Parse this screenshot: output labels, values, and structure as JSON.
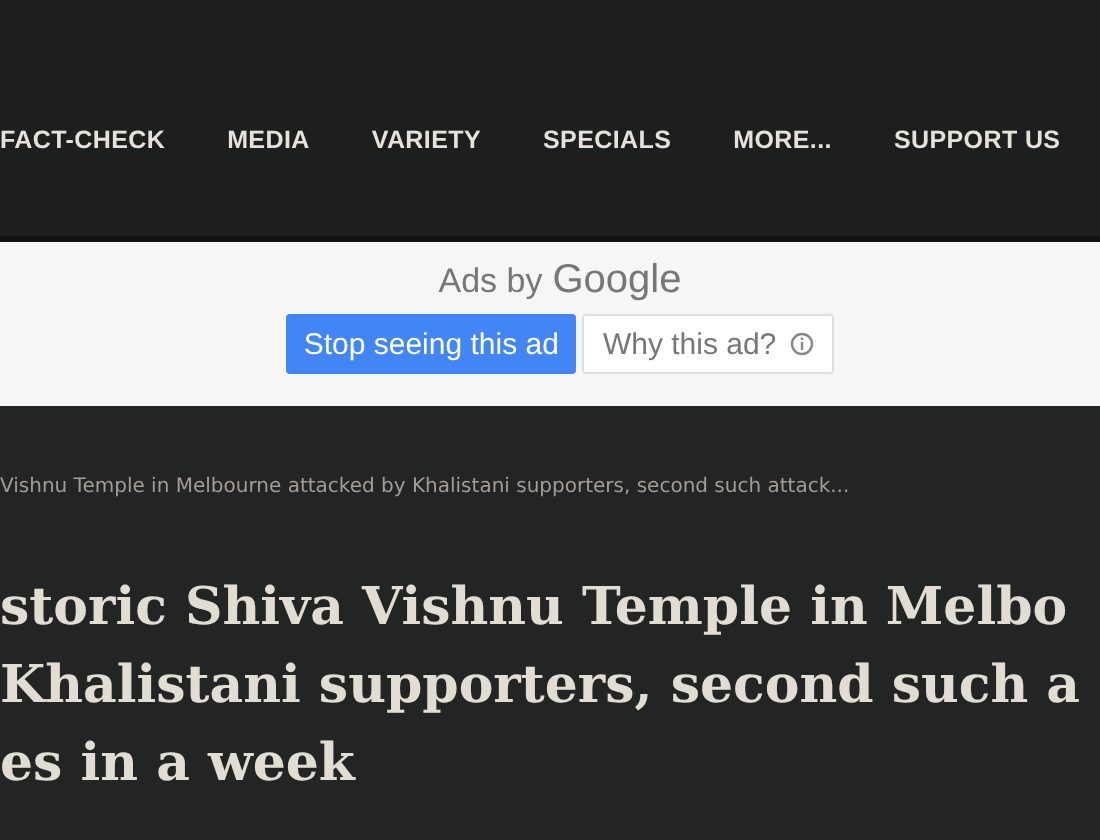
{
  "nav": {
    "items": [
      "FACT-CHECK",
      "MEDIA",
      "VARIETY",
      "SPECIALS",
      "MORE...",
      "SUPPORT US"
    ]
  },
  "ad": {
    "label": "Ads by",
    "brand": "Google",
    "buttons": [
      {
        "label": "Stop seeing this ad",
        "kind": "primary"
      },
      {
        "label": "Why this ad?",
        "kind": "info"
      }
    ]
  },
  "breadcrumb": "Vishnu Temple in Melbourne attacked by Khalistani supporters, second such attack...",
  "headline": [
    "storic Shiva Vishnu Temple in Melbo",
    "Khalistani supporters, second such a",
    "es in a week"
  ]
}
